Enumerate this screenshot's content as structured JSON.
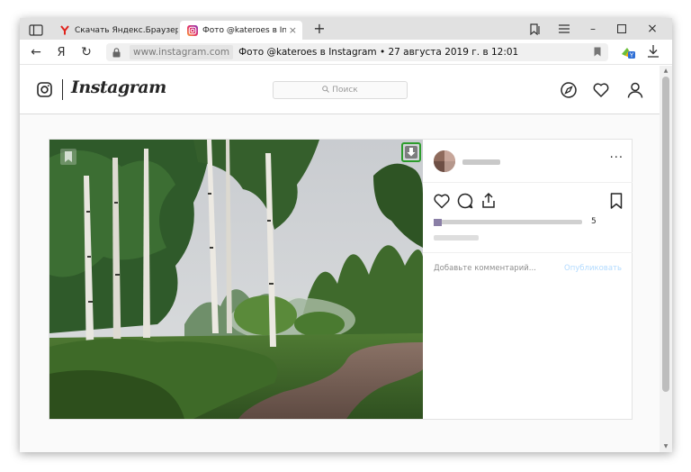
{
  "browser": {
    "tabs": [
      {
        "title": "Скачать Яндекс.Браузер д",
        "favicon": "yandex-favicon",
        "active": false
      },
      {
        "title": "Фото @kateroes в Instag",
        "favicon": "instagram-favicon",
        "active": true,
        "close": "×"
      }
    ],
    "new_tab": "+",
    "window_controls": {
      "minimize": "–",
      "maximize": "☐",
      "close": "×"
    },
    "nav": {
      "back": "←",
      "yandex": "Я",
      "reload": "↻"
    },
    "address": {
      "domain": "www.instagram.com",
      "page_title": "Фото @kateroes в Instagram • 27 августа 2019 г. в 12:01"
    }
  },
  "instagram": {
    "logo": "Instagram",
    "search_placeholder": "Поиск",
    "post": {
      "likes_count_suffix": "5",
      "more": "···",
      "comment_placeholder": "Добавьте комментарий...",
      "publish_label": "Опубликовать"
    }
  },
  "colors": {
    "download_highlight": "#2c9c2c",
    "publish_link": "#b3dbff",
    "tab_strip": "#e1e1e1"
  }
}
